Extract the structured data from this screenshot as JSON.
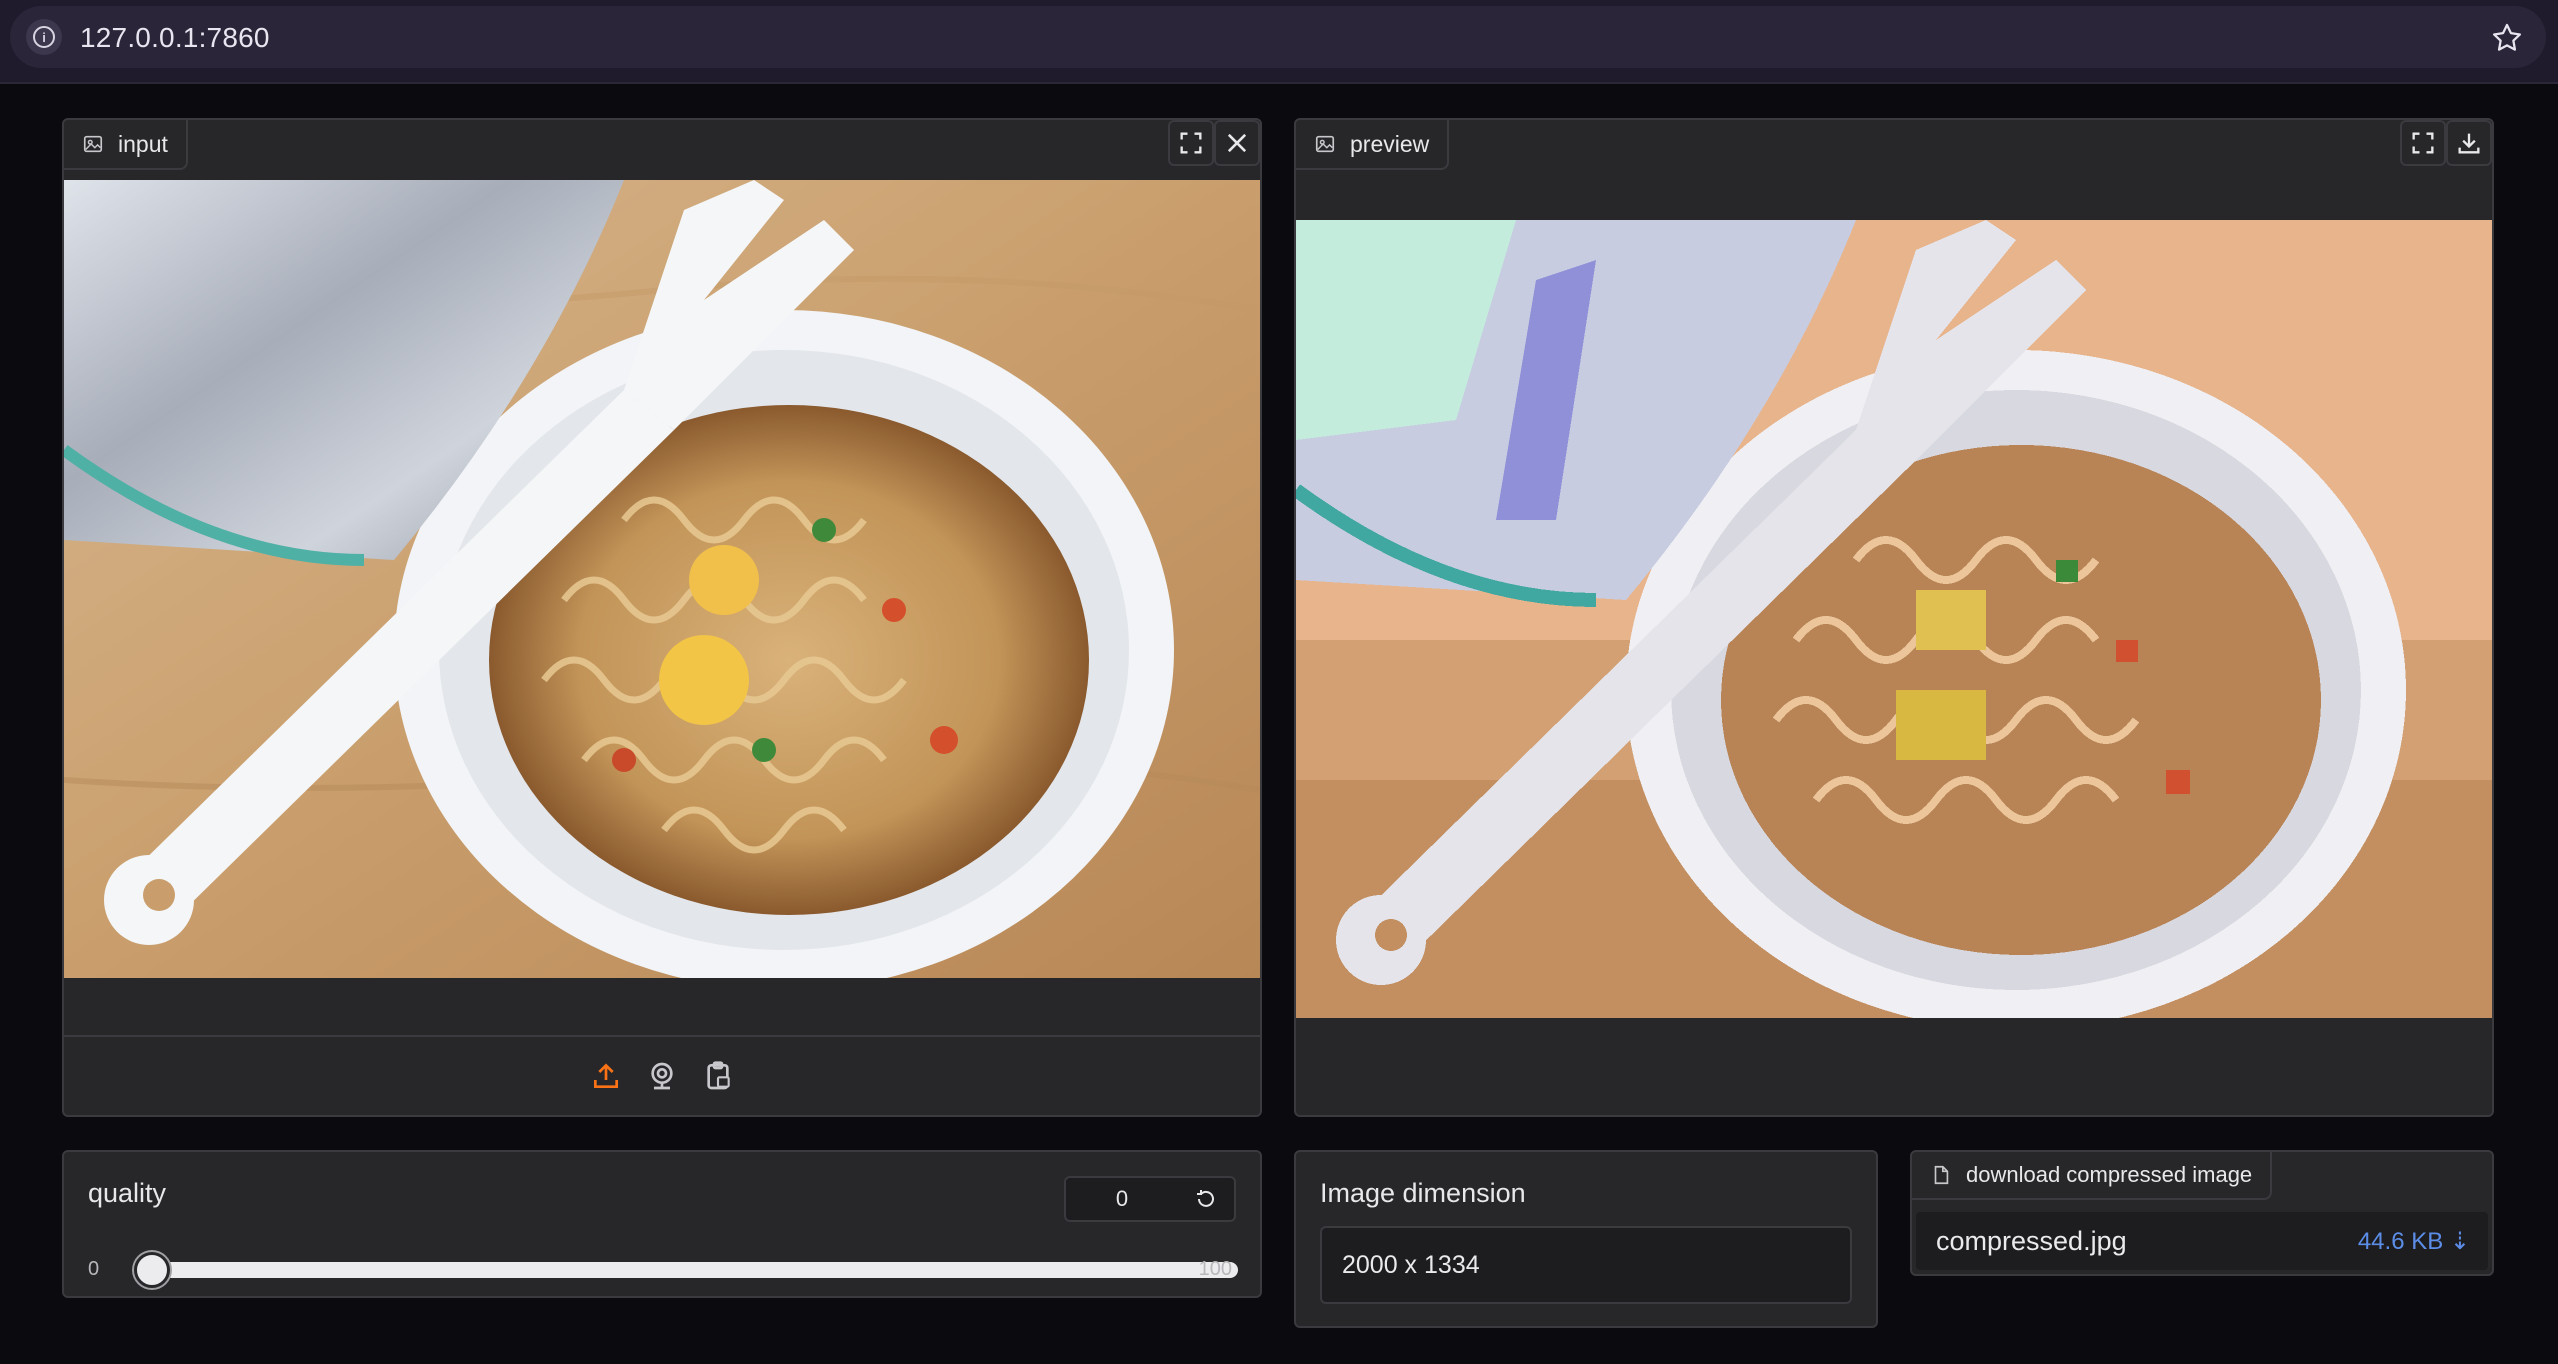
{
  "browser": {
    "url": "127.0.0.1:7860"
  },
  "input_panel": {
    "label": "input"
  },
  "preview_panel": {
    "label": "preview"
  },
  "quality": {
    "label": "quality",
    "value": "0",
    "min": "0",
    "max": "100",
    "fraction": 0
  },
  "dimension": {
    "label": "Image dimension",
    "value": "2000 x 1334"
  },
  "download": {
    "label": "download compressed image",
    "file_name": "compressed.jpg",
    "file_size": "44.6 KB ⇣"
  },
  "colors": {
    "accent": "#f97316",
    "link": "#5c8ee8",
    "background": "#0b0b0f",
    "panel": "#27272a"
  }
}
